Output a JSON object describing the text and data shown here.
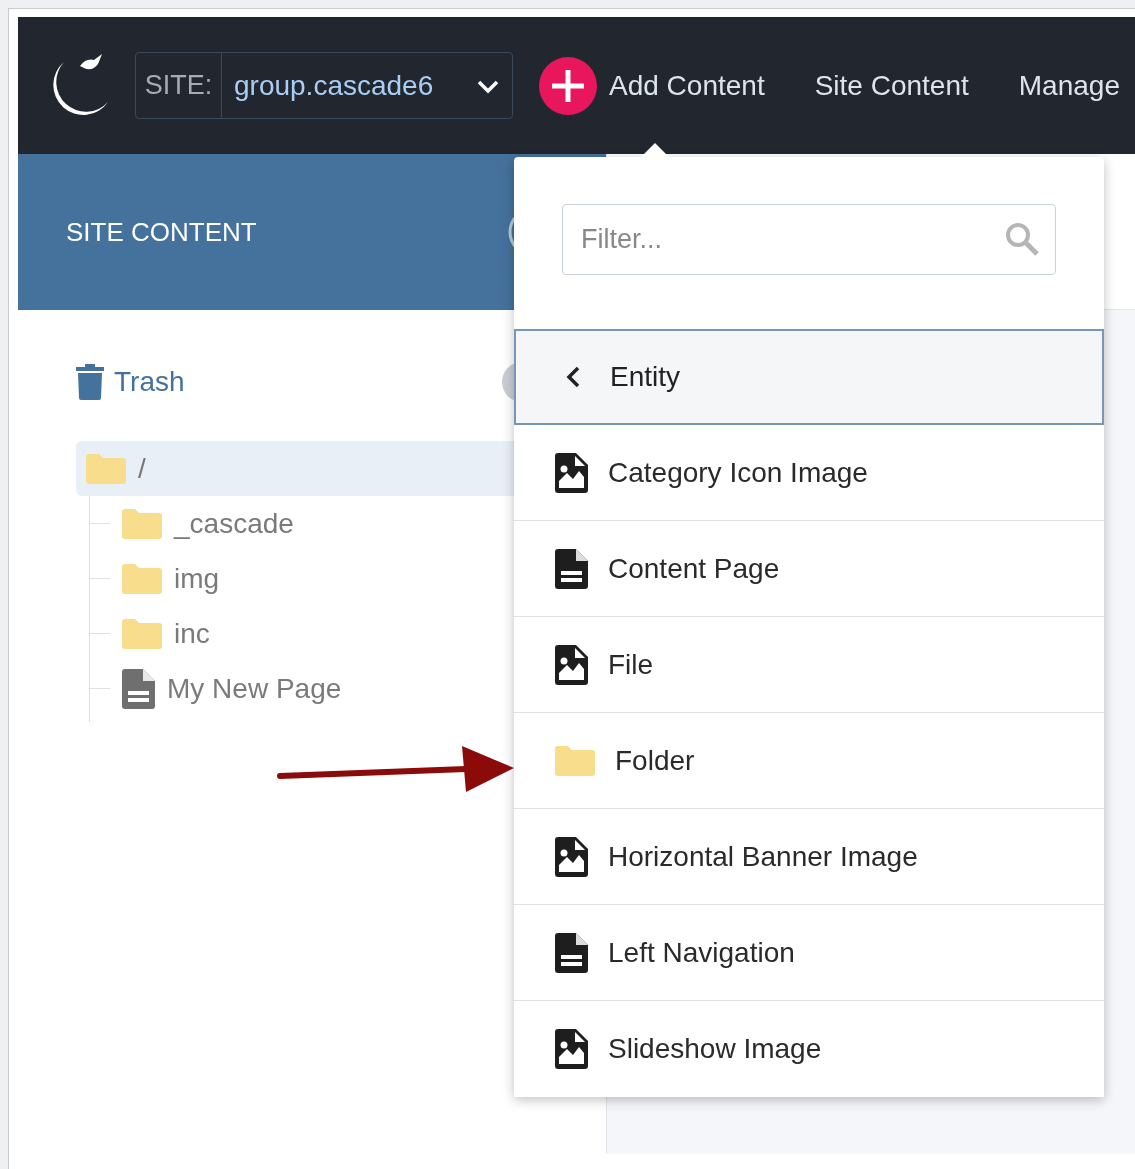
{
  "nav": {
    "site_label": "SITE:",
    "site_value": "group.cascade6",
    "links": [
      {
        "label": "Add Content",
        "kind": "add"
      },
      {
        "label": "Site Content",
        "kind": "plain"
      },
      {
        "label": "Manage",
        "kind": "plain"
      }
    ]
  },
  "sidebar": {
    "title": "SITE CONTENT",
    "trash": "Trash",
    "tree": [
      {
        "label": "/",
        "kind": "folder",
        "selected": true,
        "children": [
          {
            "label": "_cascade",
            "kind": "folder",
            "selected": false
          },
          {
            "label": "img",
            "kind": "folder",
            "selected": false
          },
          {
            "label": "inc",
            "kind": "folder",
            "selected": false
          },
          {
            "label": "My New Page",
            "kind": "page",
            "selected": false
          }
        ]
      }
    ]
  },
  "menu": {
    "filter_placeholder": "Filter...",
    "back": "Entity",
    "items": [
      {
        "label": "Category Icon Image",
        "kind": "image"
      },
      {
        "label": "Content Page",
        "kind": "page"
      },
      {
        "label": "File",
        "kind": "image"
      },
      {
        "label": "Folder",
        "kind": "folder"
      },
      {
        "label": "Horizontal Banner Image",
        "kind": "image"
      },
      {
        "label": "Left Navigation",
        "kind": "page"
      },
      {
        "label": "Slideshow Image",
        "kind": "image"
      }
    ]
  }
}
